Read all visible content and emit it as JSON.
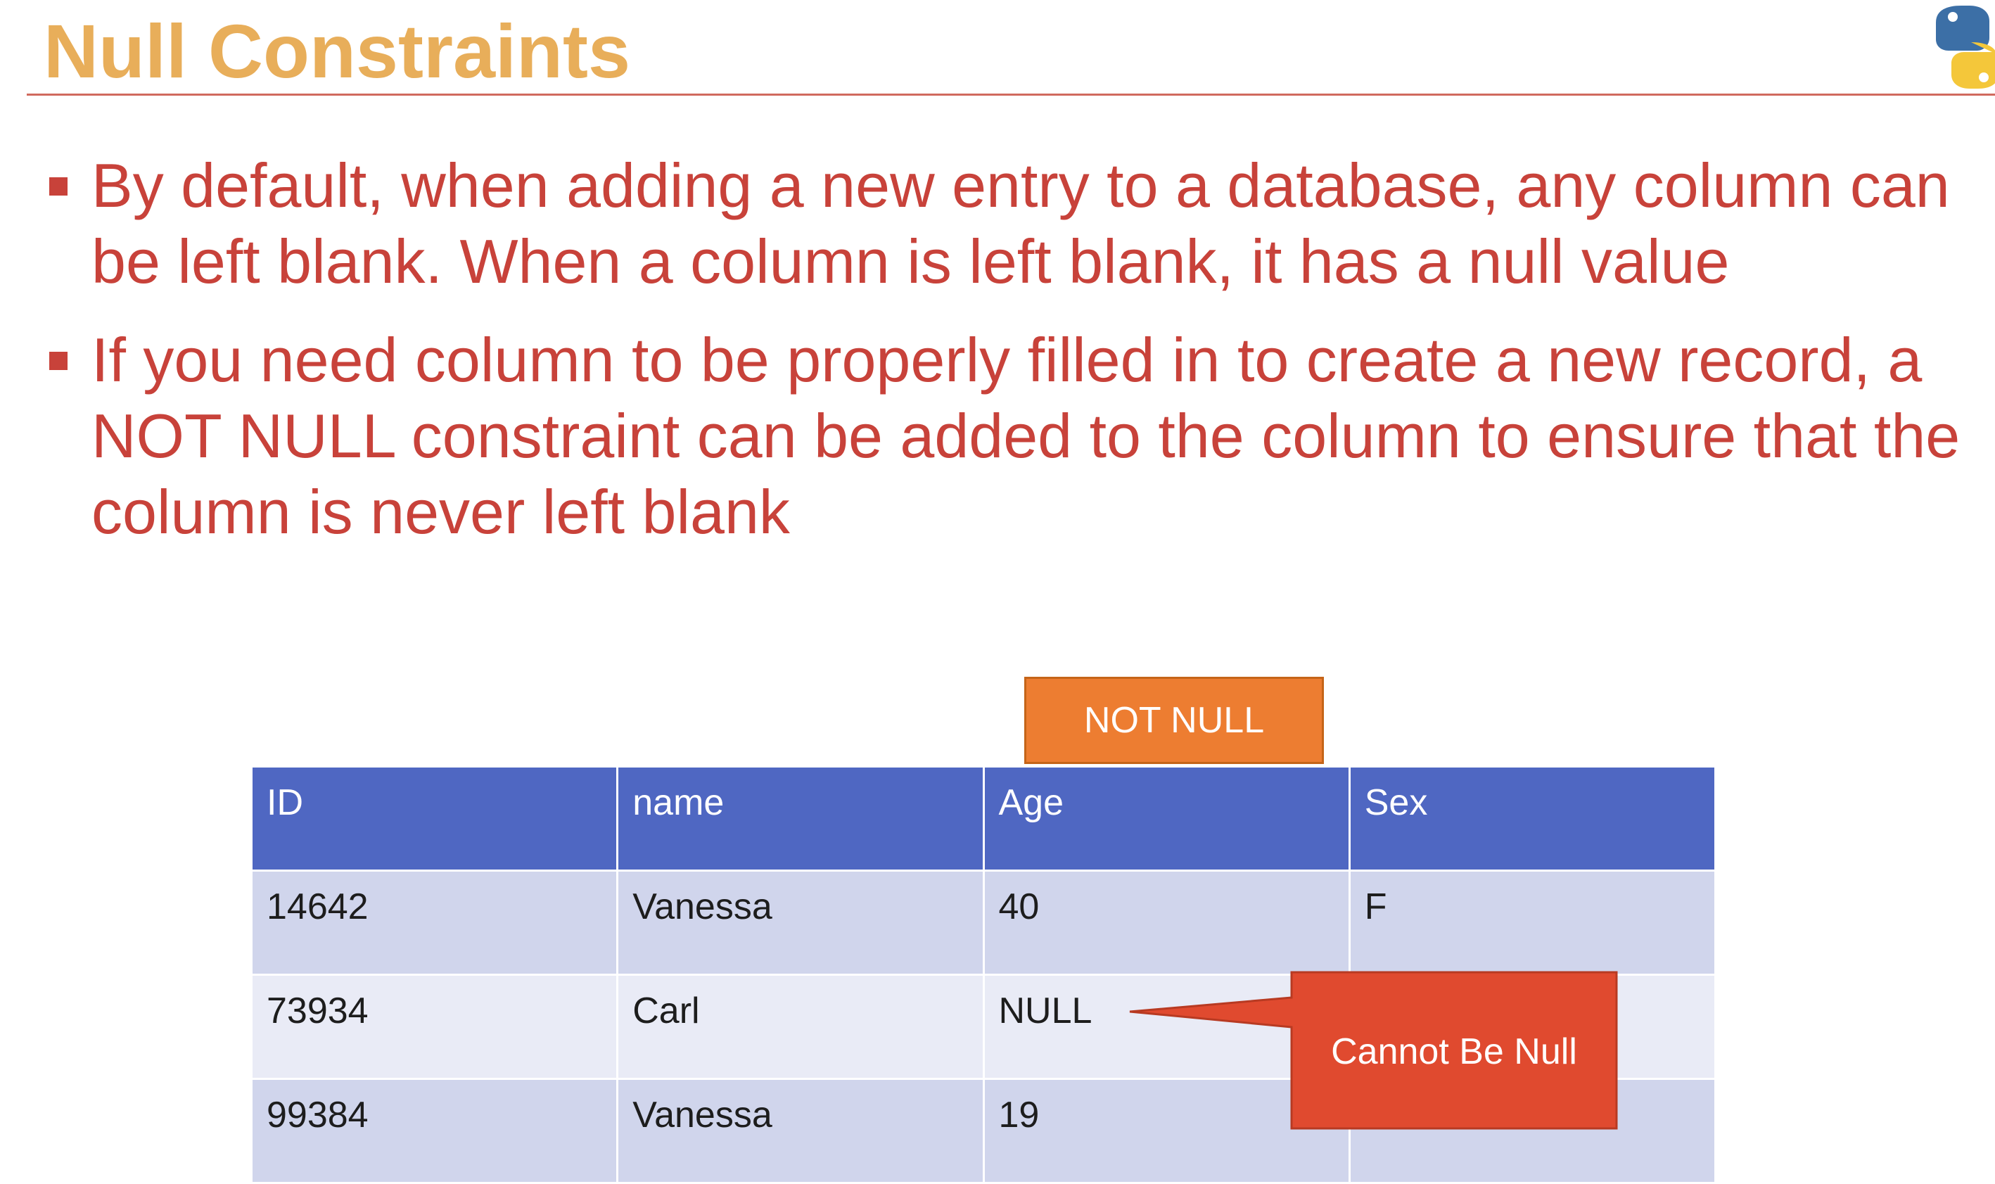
{
  "slide": {
    "title": "Null Constraints",
    "bullets": [
      "By default, when adding a new entry to a database, any column can be left blank. When a column is left blank, it has a null value",
      "If you need column to be properly filled in to create a new record, a NOT NULL constraint can be added to the column to ensure that the column is never left blank"
    ],
    "logo_icon": "python-logo-icon"
  },
  "not_null_tag": "NOT NULL",
  "table": {
    "headers": [
      "ID",
      "name",
      "Age",
      "Sex"
    ],
    "rows": [
      [
        "14642",
        "Vanessa",
        "40",
        "F"
      ],
      [
        "73934",
        "Carl",
        "NULL",
        ""
      ],
      [
        "99384",
        "Vanessa",
        "19",
        ""
      ]
    ]
  },
  "callout": {
    "text": "Cannot Be Null"
  },
  "colors": {
    "title": "#E8AE5A",
    "body_text": "#C8423A",
    "header_bg": "#4F67C2",
    "row_odd_bg": "#D0D5EC",
    "row_even_bg": "#E9EBF6",
    "tag_bg": "#ED7D31",
    "callout_bg": "#E04A2F"
  }
}
